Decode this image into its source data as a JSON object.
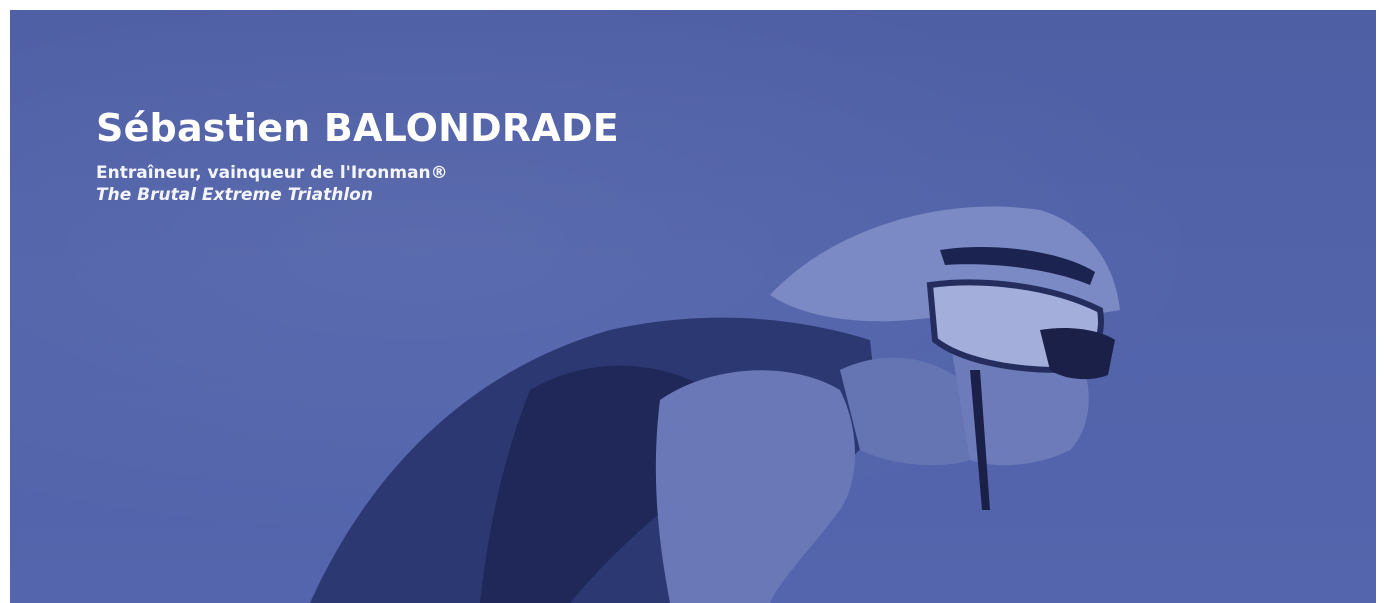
{
  "banner": {
    "name": "Sébastien BALONDRADE",
    "subtitle": "Entraîneur, vainqueur de l'Ironman®",
    "tagline": "The Brutal Extreme Triathlon",
    "colors": {
      "background": "#5263aa",
      "text": "#ffffff"
    }
  }
}
